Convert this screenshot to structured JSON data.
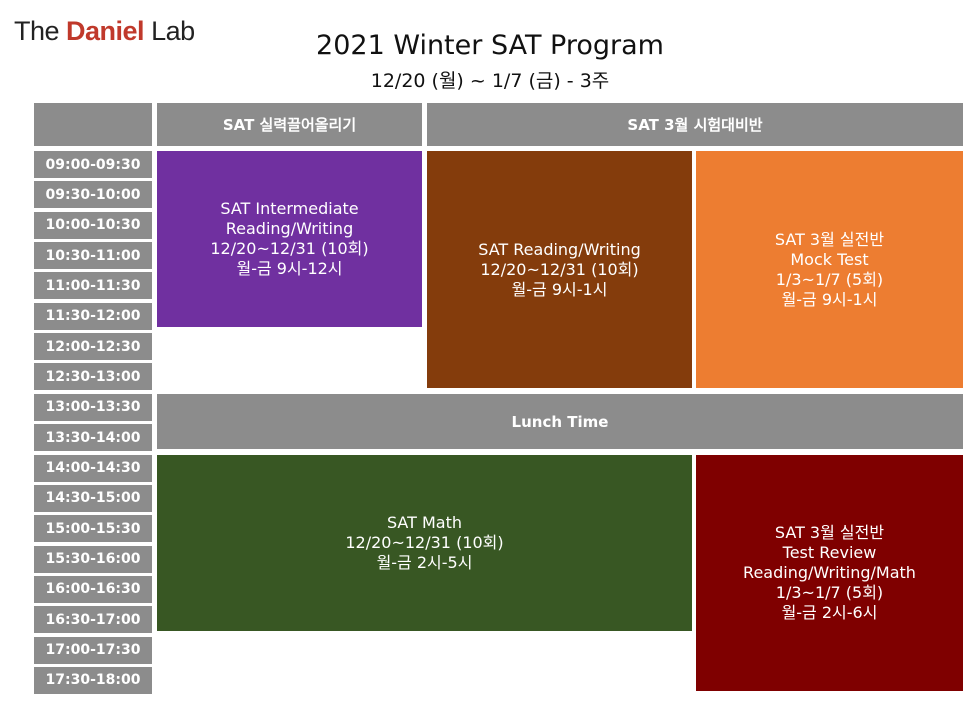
{
  "logo": {
    "prefix": "The ",
    "brand": "Daniel",
    "suffix": " Lab"
  },
  "title": "2021 Winter SAT Program",
  "subtitle": "12/20 (월) ~ 1/7 (금) - 3주",
  "headers": {
    "blank": "",
    "col1": "SAT 실력끌어올리기",
    "col2": "SAT 3월 시험대비반"
  },
  "times": [
    "09:00-09:30",
    "09:30-10:00",
    "10:00-10:30",
    "10:30-11:00",
    "11:00-11:30",
    "11:30-12:00",
    "12:00-12:30",
    "12:30-13:00",
    "13:00-13:30",
    "13:30-14:00",
    "14:00-14:30",
    "14:30-15:00",
    "15:00-15:30",
    "15:30-16:00",
    "16:00-16:30",
    "16:30-17:00",
    "17:00-17:30",
    "17:30-18:00"
  ],
  "blocks": {
    "intermediate": {
      "color": "#7030a0",
      "lines": [
        "SAT Intermediate",
        "Reading/Writing",
        "12/20~12/31 (10회)",
        "월-금 9시-12시"
      ]
    },
    "reading_writing": {
      "color": "#843c0c",
      "lines": [
        "SAT Reading/Writing",
        "12/20~12/31 (10회)",
        "월-금 9시-1시"
      ]
    },
    "mock_test": {
      "color": "#ed7d31",
      "lines": [
        "SAT 3월 실전반",
        "Mock Test",
        "1/3~1/7 (5회)",
        "월-금 9시-1시"
      ]
    },
    "lunch": {
      "color": "#8c8c8c",
      "lines": [
        "Lunch Time"
      ]
    },
    "math": {
      "color": "#385723",
      "lines": [
        "SAT Math",
        "12/20~12/31 (10회)",
        "월-금 2시-5시"
      ]
    },
    "test_review": {
      "color": "#7f0000",
      "lines": [
        "SAT 3월 실전반",
        "Test Review",
        "Reading/Writing/Math",
        "1/3~1/7 (5회)",
        "월-금 2시-6시"
      ]
    }
  }
}
